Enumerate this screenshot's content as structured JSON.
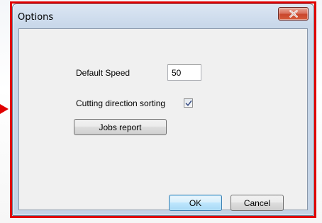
{
  "dialog": {
    "title": "Options",
    "close_icon": "close-x-icon"
  },
  "form": {
    "default_speed_label": "Default Speed",
    "default_speed_value": "50",
    "cutting_direction_label": "Cutting direction sorting",
    "cutting_direction_checked": true
  },
  "buttons": {
    "jobs_report": "Jobs report",
    "ok": "OK",
    "cancel": "Cancel"
  },
  "colors": {
    "highlight_frame": "#e00000",
    "close_button": "#c9462c",
    "client_area": "#f0f0f0"
  }
}
